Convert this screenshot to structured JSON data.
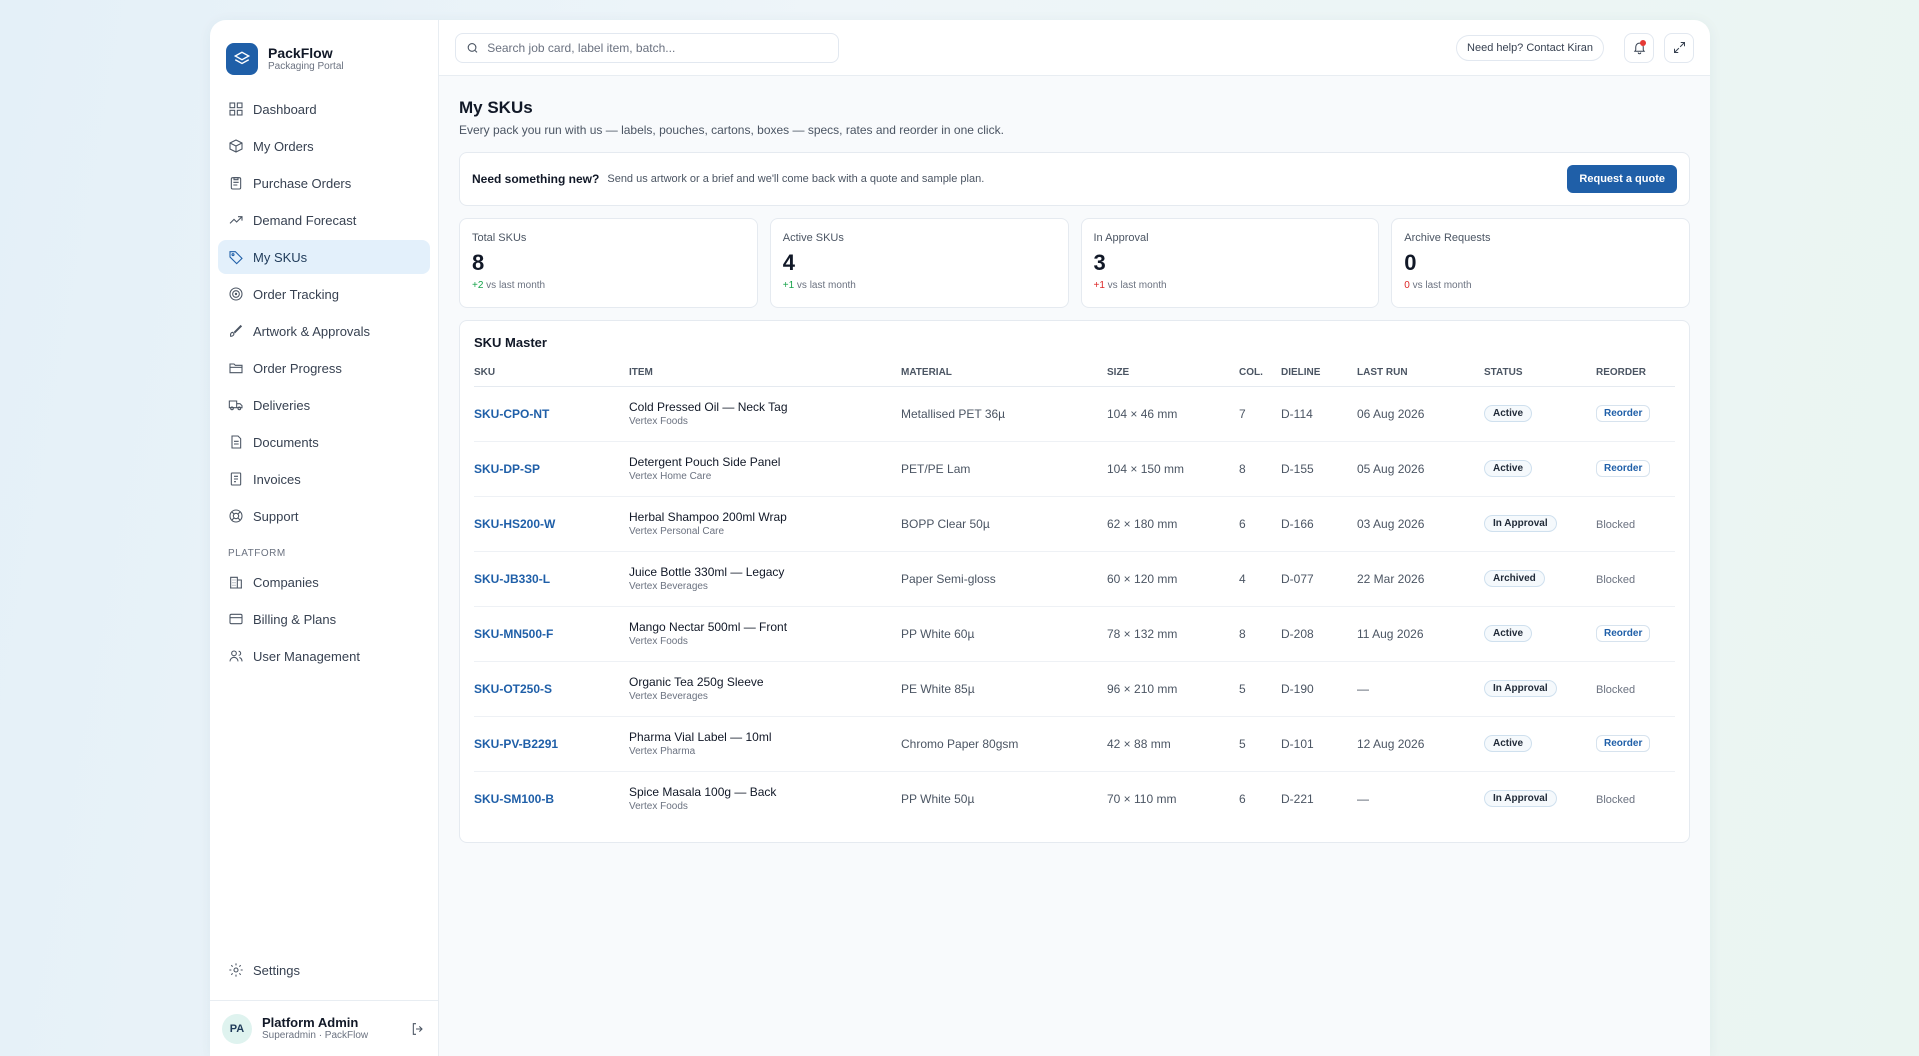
{
  "brand": {
    "name": "PackFlow",
    "subtitle": "Packaging Portal"
  },
  "sidebar": {
    "items": [
      {
        "label": "Dashboard",
        "icon": "dashboard-icon"
      },
      {
        "label": "My Orders",
        "icon": "box-icon"
      },
      {
        "label": "Purchase Orders",
        "icon": "clipboard-icon"
      },
      {
        "label": "Demand Forecast",
        "icon": "trend-icon"
      },
      {
        "label": "My SKUs",
        "icon": "tag-icon",
        "active": true
      },
      {
        "label": "Order Tracking",
        "icon": "target-icon"
      },
      {
        "label": "Artwork & Approvals",
        "icon": "brush-icon"
      },
      {
        "label": "Order Progress",
        "icon": "folder-icon"
      },
      {
        "label": "Deliveries",
        "icon": "truck-icon"
      },
      {
        "label": "Documents",
        "icon": "document-icon"
      },
      {
        "label": "Invoices",
        "icon": "invoice-icon"
      },
      {
        "label": "Support",
        "icon": "lifebuoy-icon"
      }
    ],
    "section_label": "PLATFORM",
    "platform_items": [
      {
        "label": "Companies",
        "icon": "building-icon"
      },
      {
        "label": "Billing & Plans",
        "icon": "card-icon"
      },
      {
        "label": "User Management",
        "icon": "users-icon"
      }
    ],
    "settings_label": "Settings"
  },
  "user": {
    "initials": "PA",
    "name": "Platform Admin",
    "role": "Superadmin · PackFlow"
  },
  "topbar": {
    "search_placeholder": "Search job card, label item, batch...",
    "help_label": "Need help? Contact Kiran"
  },
  "page": {
    "title": "My SKUs",
    "subtitle": "Every pack you run with us — labels, pouches, cartons, boxes — specs, rates and reorder in one click."
  },
  "banner": {
    "title": "Need something new?",
    "text": "Send us artwork or a brief and we'll come back with a quote and sample plan.",
    "button": "Request a quote"
  },
  "stats": [
    {
      "label": "Total SKUs",
      "value": "8",
      "delta": "+2",
      "delta_text": " vs last month",
      "tone": "pos"
    },
    {
      "label": "Active SKUs",
      "value": "4",
      "delta": "+1",
      "delta_text": " vs last month",
      "tone": "pos"
    },
    {
      "label": "In Approval",
      "value": "3",
      "delta": "+1",
      "delta_text": " vs last month",
      "tone": "neg"
    },
    {
      "label": "Archive Requests",
      "value": "0",
      "delta": "0",
      "delta_text": " vs last month",
      "tone": "zero"
    }
  ],
  "table": {
    "title": "SKU Master",
    "columns": [
      "SKU",
      "ITEM",
      "MATERIAL",
      "SIZE",
      "COL.",
      "DIELINE",
      "LAST RUN",
      "STATUS",
      "REORDER"
    ],
    "rows": [
      {
        "sku": "SKU-CPO-NT",
        "item": "Cold Pressed Oil — Neck Tag",
        "company": "Vertex Foods",
        "material": "Metallised PET 36µ",
        "size": "104 × 46 mm",
        "col": "7",
        "dieline": "D-114",
        "last_run": "06 Aug 2026",
        "status": "Active",
        "reorder": "Reorder"
      },
      {
        "sku": "SKU-DP-SP",
        "item": "Detergent Pouch Side Panel",
        "company": "Vertex Home Care",
        "material": "PET/PE Lam",
        "size": "104 × 150 mm",
        "col": "8",
        "dieline": "D-155",
        "last_run": "05 Aug 2026",
        "status": "Active",
        "reorder": "Reorder"
      },
      {
        "sku": "SKU-HS200-W",
        "item": "Herbal Shampoo 200ml Wrap",
        "company": "Vertex Personal Care",
        "material": "BOPP Clear 50µ",
        "size": "62 × 180 mm",
        "col": "6",
        "dieline": "D-166",
        "last_run": "03 Aug 2026",
        "status": "In Approval",
        "reorder": "Blocked"
      },
      {
        "sku": "SKU-JB330-L",
        "item": "Juice Bottle 330ml — Legacy",
        "company": "Vertex Beverages",
        "material": "Paper Semi-gloss",
        "size": "60 × 120 mm",
        "col": "4",
        "dieline": "D-077",
        "last_run": "22 Mar 2026",
        "status": "Archived",
        "reorder": "Blocked"
      },
      {
        "sku": "SKU-MN500-F",
        "item": "Mango Nectar 500ml — Front",
        "company": "Vertex Foods",
        "material": "PP White 60µ",
        "size": "78 × 132 mm",
        "col": "8",
        "dieline": "D-208",
        "last_run": "11 Aug 2026",
        "status": "Active",
        "reorder": "Reorder"
      },
      {
        "sku": "SKU-OT250-S",
        "item": "Organic Tea 250g Sleeve",
        "company": "Vertex Beverages",
        "material": "PE White 85µ",
        "size": "96 × 210 mm",
        "col": "5",
        "dieline": "D-190",
        "last_run": "—",
        "status": "In Approval",
        "reorder": "Blocked"
      },
      {
        "sku": "SKU-PV-B2291",
        "item": "Pharma Vial Label — 10ml",
        "company": "Vertex Pharma",
        "material": "Chromo Paper 80gsm",
        "size": "42 × 88 mm",
        "col": "5",
        "dieline": "D-101",
        "last_run": "12 Aug 2026",
        "status": "Active",
        "reorder": "Reorder"
      },
      {
        "sku": "SKU-SM100-B",
        "item": "Spice Masala 100g — Back",
        "company": "Vertex Foods",
        "material": "PP White 50µ",
        "size": "70 × 110 mm",
        "col": "6",
        "dieline": "D-221",
        "last_run": "—",
        "status": "In Approval",
        "reorder": "Blocked"
      }
    ]
  }
}
